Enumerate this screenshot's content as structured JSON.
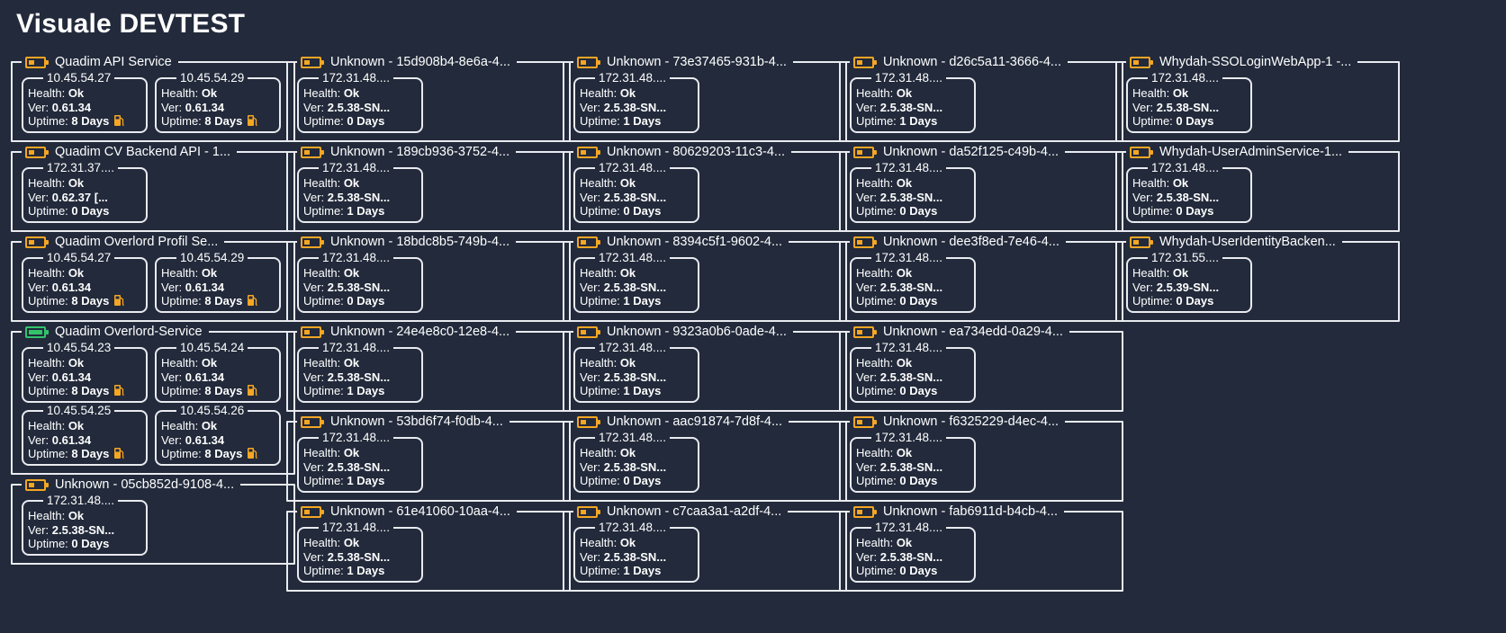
{
  "page": {
    "title": "Visuale DEVTEST"
  },
  "labels": {
    "health": "Health: ",
    "ver": "Ver: ",
    "uptime": "Uptime: "
  },
  "colors": {
    "background": "#222a3b",
    "border": "#e9ebf0",
    "battery_warn": "#f5a623",
    "battery_ok": "#31c46b"
  },
  "columns": [
    {
      "services": [
        {
          "name": "Quadim API Service",
          "battery": "orange",
          "nodes": [
            {
              "ip": "10.45.54.27",
              "health": "Ok",
              "version": "0.61.34",
              "uptime": "8 Days",
              "icon": "fuel-pump-icon"
            },
            {
              "ip": "10.45.54.29",
              "health": "Ok",
              "version": "0.61.34",
              "uptime": "8 Days",
              "icon": "fuel-pump-icon"
            }
          ]
        },
        {
          "name": "Quadim CV Backend API - 1...",
          "battery": "orange",
          "nodes": [
            {
              "ip": "172.31.37....",
              "health": "Ok",
              "version": "0.62.37 [...",
              "uptime": "0 Days"
            }
          ]
        },
        {
          "name": "Quadim Overlord Profil Se...",
          "battery": "orange",
          "nodes": [
            {
              "ip": "10.45.54.27",
              "health": "Ok",
              "version": "0.61.34",
              "uptime": "8 Days",
              "icon": "fuel-pump-icon"
            },
            {
              "ip": "10.45.54.29",
              "health": "Ok",
              "version": "0.61.34",
              "uptime": "8 Days",
              "icon": "fuel-pump-icon"
            }
          ]
        },
        {
          "name": "Quadim Overlord-Service",
          "battery": "green",
          "nodes": [
            {
              "ip": "10.45.54.23",
              "health": "Ok",
              "version": "0.61.34",
              "uptime": "8 Days",
              "icon": "fuel-pump-icon"
            },
            {
              "ip": "10.45.54.24",
              "health": "Ok",
              "version": "0.61.34",
              "uptime": "8 Days",
              "icon": "fuel-pump-icon"
            },
            {
              "ip": "10.45.54.25",
              "health": "Ok",
              "version": "0.61.34",
              "uptime": "8 Days",
              "icon": "fuel-pump-icon"
            },
            {
              "ip": "10.45.54.26",
              "health": "Ok",
              "version": "0.61.34",
              "uptime": "8 Days",
              "icon": "fuel-pump-icon"
            }
          ]
        },
        {
          "name": "Unknown - 05cb852d-9108-4...",
          "battery": "orange",
          "nodes": [
            {
              "ip": "172.31.48....",
              "health": "Ok",
              "version": "2.5.38-SN...",
              "uptime": "0 Days"
            }
          ]
        }
      ]
    },
    {
      "services": [
        {
          "name": "Unknown - 15d908b4-8e6a-4...",
          "battery": "orange",
          "nodes": [
            {
              "ip": "172.31.48....",
              "health": "Ok",
              "version": "2.5.38-SN...",
              "uptime": "0 Days"
            }
          ]
        },
        {
          "name": "Unknown - 189cb936-3752-4...",
          "battery": "orange",
          "nodes": [
            {
              "ip": "172.31.48....",
              "health": "Ok",
              "version": "2.5.38-SN...",
              "uptime": "1 Days"
            }
          ]
        },
        {
          "name": "Unknown - 18bdc8b5-749b-4...",
          "battery": "orange",
          "nodes": [
            {
              "ip": "172.31.48....",
              "health": "Ok",
              "version": "2.5.38-SN...",
              "uptime": "0 Days"
            }
          ]
        },
        {
          "name": "Unknown - 24e4e8c0-12e8-4...",
          "battery": "orange",
          "nodes": [
            {
              "ip": "172.31.48....",
              "health": "Ok",
              "version": "2.5.38-SN...",
              "uptime": "1 Days"
            }
          ]
        },
        {
          "name": "Unknown - 53bd6f74-f0db-4...",
          "battery": "orange",
          "nodes": [
            {
              "ip": "172.31.48....",
              "health": "Ok",
              "version": "2.5.38-SN...",
              "uptime": "1 Days"
            }
          ]
        },
        {
          "name": "Unknown - 61e41060-10aa-4...",
          "battery": "orange",
          "nodes": [
            {
              "ip": "172.31.48....",
              "health": "Ok",
              "version": "2.5.38-SN...",
              "uptime": "1 Days"
            }
          ]
        }
      ]
    },
    {
      "services": [
        {
          "name": "Unknown - 73e37465-931b-4...",
          "battery": "orange",
          "nodes": [
            {
              "ip": "172.31.48....",
              "health": "Ok",
              "version": "2.5.38-SN...",
              "uptime": "1 Days"
            }
          ]
        },
        {
          "name": "Unknown - 80629203-11c3-4...",
          "battery": "orange",
          "nodes": [
            {
              "ip": "172.31.48....",
              "health": "Ok",
              "version": "2.5.38-SN...",
              "uptime": "0 Days"
            }
          ]
        },
        {
          "name": "Unknown - 8394c5f1-9602-4...",
          "battery": "orange",
          "nodes": [
            {
              "ip": "172.31.48....",
              "health": "Ok",
              "version": "2.5.38-SN...",
              "uptime": "1 Days"
            }
          ]
        },
        {
          "name": "Unknown - 9323a0b6-0ade-4...",
          "battery": "orange",
          "nodes": [
            {
              "ip": "172.31.48....",
              "health": "Ok",
              "version": "2.5.38-SN...",
              "uptime": "1 Days"
            }
          ]
        },
        {
          "name": "Unknown - aac91874-7d8f-4...",
          "battery": "orange",
          "nodes": [
            {
              "ip": "172.31.48....",
              "health": "Ok",
              "version": "2.5.38-SN...",
              "uptime": "0 Days"
            }
          ]
        },
        {
          "name": "Unknown - c7caa3a1-a2df-4...",
          "battery": "orange",
          "nodes": [
            {
              "ip": "172.31.48....",
              "health": "Ok",
              "version": "2.5.38-SN...",
              "uptime": "1 Days"
            }
          ]
        }
      ]
    },
    {
      "services": [
        {
          "name": "Unknown - d26c5a11-3666-4...",
          "battery": "orange",
          "nodes": [
            {
              "ip": "172.31.48....",
              "health": "Ok",
              "version": "2.5.38-SN...",
              "uptime": "1 Days"
            }
          ]
        },
        {
          "name": "Unknown - da52f125-c49b-4...",
          "battery": "orange",
          "nodes": [
            {
              "ip": "172.31.48....",
              "health": "Ok",
              "version": "2.5.38-SN...",
              "uptime": "0 Days"
            }
          ]
        },
        {
          "name": "Unknown - dee3f8ed-7e46-4...",
          "battery": "orange",
          "nodes": [
            {
              "ip": "172.31.48....",
              "health": "Ok",
              "version": "2.5.38-SN...",
              "uptime": "0 Days"
            }
          ]
        },
        {
          "name": "Unknown - ea734edd-0a29-4...",
          "battery": "orange",
          "nodes": [
            {
              "ip": "172.31.48....",
              "health": "Ok",
              "version": "2.5.38-SN...",
              "uptime": "0 Days"
            }
          ]
        },
        {
          "name": "Unknown - f6325229-d4ec-4...",
          "battery": "orange",
          "nodes": [
            {
              "ip": "172.31.48....",
              "health": "Ok",
              "version": "2.5.38-SN...",
              "uptime": "0 Days"
            }
          ]
        },
        {
          "name": "Unknown - fab6911d-b4cb-4...",
          "battery": "orange",
          "nodes": [
            {
              "ip": "172.31.48....",
              "health": "Ok",
              "version": "2.5.38-SN...",
              "uptime": "0 Days"
            }
          ]
        }
      ]
    },
    {
      "services": [
        {
          "name": "Whydah-SSOLoginWebApp-1 -...",
          "battery": "orange",
          "nodes": [
            {
              "ip": "172.31.48....",
              "health": "Ok",
              "version": "2.5.38-SN...",
              "uptime": "0 Days"
            }
          ]
        },
        {
          "name": "Whydah-UserAdminService-1...",
          "battery": "orange",
          "nodes": [
            {
              "ip": "172.31.48....",
              "health": "Ok",
              "version": "2.5.38-SN...",
              "uptime": "0 Days"
            }
          ]
        },
        {
          "name": "Whydah-UserIdentityBacken...",
          "battery": "orange",
          "nodes": [
            {
              "ip": "172.31.55....",
              "health": "Ok",
              "version": "2.5.39-SN...",
              "uptime": "0 Days"
            }
          ]
        }
      ]
    }
  ]
}
